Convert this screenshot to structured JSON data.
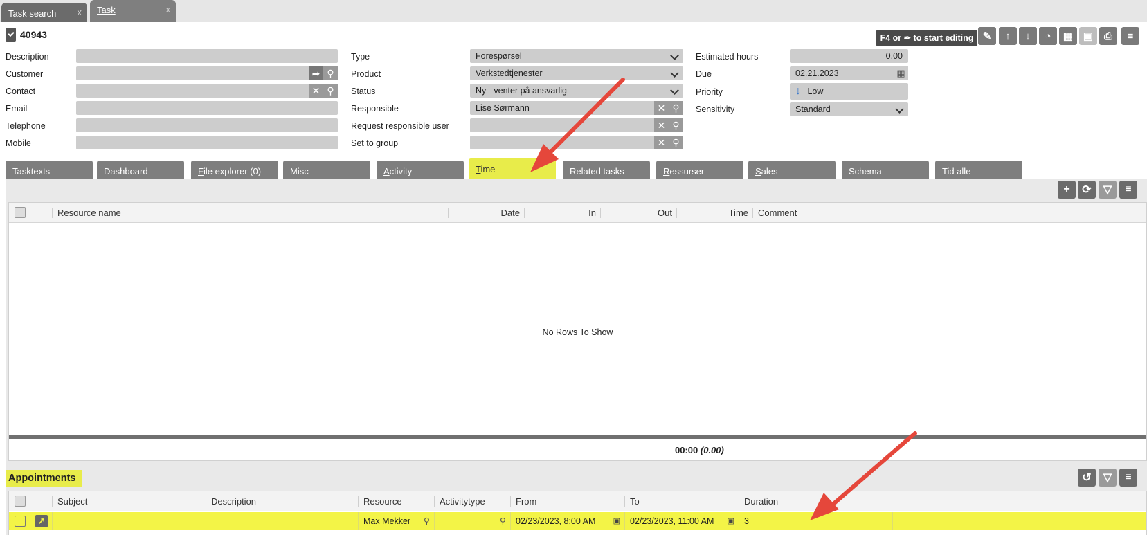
{
  "window_tabs": [
    {
      "label": "Task search",
      "close": "x"
    },
    {
      "label": "Task",
      "close": "x"
    }
  ],
  "header": {
    "task_number": "40943",
    "edit_hint": "F4 or ✒ to start editing",
    "toolbar_icons": [
      "edit-icon",
      "arrow-up-icon",
      "arrow-down-icon",
      "stopwatch-icon",
      "calendar-add-icon",
      "save-icon",
      "print-icon",
      "menu-icon"
    ]
  },
  "form": {
    "left": {
      "description_label": "Description",
      "description_value": "",
      "customer_label": "Customer",
      "customer_value": "",
      "contact_label": "Contact",
      "contact_value": "",
      "email_label": "Email",
      "email_value": "",
      "telephone_label": "Telephone",
      "telephone_value": "",
      "mobile_label": "Mobile",
      "mobile_value": ""
    },
    "middle": {
      "type_label": "Type",
      "type_value": "Forespørsel",
      "product_label": "Product",
      "product_value": "Verkstedtjenester",
      "status_label": "Status",
      "status_value": "Ny - venter på ansvarlig",
      "responsible_label": "Responsible",
      "responsible_value": "Lise Sørmann",
      "request_responsible_label": "Request responsible user",
      "request_responsible_value": "",
      "set_to_group_label": "Set to group",
      "set_to_group_value": ""
    },
    "right": {
      "estimated_hours_label": "Estimated hours",
      "estimated_hours_value": "0.00",
      "due_label": "Due",
      "due_value": "02.21.2023",
      "priority_label": "Priority",
      "priority_value": "Low",
      "sensitivity_label": "Sensitivity",
      "sensitivity_value": "Standard"
    }
  },
  "tabs": [
    {
      "label": "Tasktexts"
    },
    {
      "label": "Dashboard"
    },
    {
      "first": "F",
      "rest": "ile explorer (0)"
    },
    {
      "label": "Misc"
    },
    {
      "first": "A",
      "rest": "ctivity"
    },
    {
      "first": "T",
      "rest": "ime"
    },
    {
      "label": "Related tasks"
    },
    {
      "first": "R",
      "rest": "essurser"
    },
    {
      "first": "S",
      "rest": "ales"
    },
    {
      "label": "Schema"
    },
    {
      "label": "Tid alle"
    }
  ],
  "time_grid": {
    "columns": [
      "Resource name",
      "Date",
      "In",
      "Out",
      "Time",
      "Comment"
    ],
    "empty_text": "No Rows To Show",
    "total_time": "00:00",
    "total_decimal": "(0.00)"
  },
  "appointments": {
    "title": "Appointments",
    "columns": [
      "Subject",
      "Description",
      "Resource",
      "Activitytype",
      "From",
      "To",
      "Duration"
    ],
    "rows": [
      {
        "subject": "",
        "description": "",
        "resource": "Max Mekker",
        "activitytype": "",
        "from": "02/23/2023, 8:00 AM",
        "to": "02/23/2023, 11:00 AM",
        "duration": "3"
      }
    ]
  },
  "colors": {
    "highlight": "#e8ec4a",
    "arrow": "#e5473b",
    "tab": "#7e7e7e"
  }
}
